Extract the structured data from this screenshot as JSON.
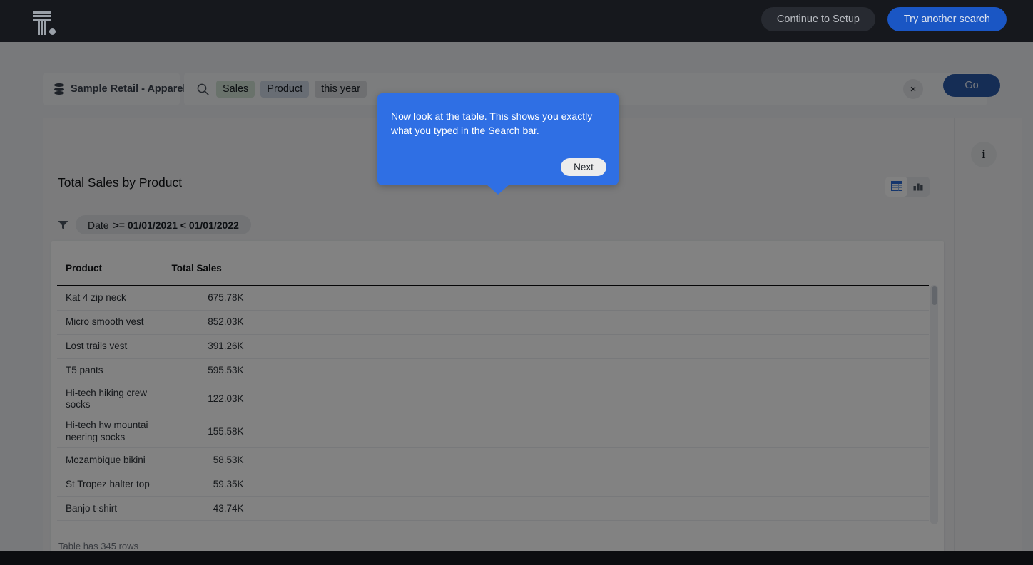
{
  "top_nav": {
    "logo_name": "thoughtspot-logo",
    "continue_setup_label": "Continue to Setup",
    "try_another_search_label": "Try another search"
  },
  "search": {
    "datasource": "Sample Retail - Apparel",
    "tokens": [
      {
        "text": "Sales",
        "kind": "measure"
      },
      {
        "text": "Product",
        "kind": "attribute"
      },
      {
        "text": "this year",
        "kind": "date"
      }
    ],
    "clear_label": "×",
    "go_label": "Go"
  },
  "answer": {
    "title": "Total Sales by Product",
    "filter": {
      "field": "Date",
      "value": ">= 01/01/2021 < 01/01/2022"
    },
    "view_toggle": {
      "table_icon": "table-icon",
      "chart_icon": "bar-chart-icon",
      "active": "table"
    },
    "info_label": "i"
  },
  "table": {
    "columns": [
      "Product",
      "Total Sales",
      ""
    ],
    "rows": [
      {
        "product": "Kat 4 zip neck",
        "total_sales": "675.78K"
      },
      {
        "product": "Micro smooth vest",
        "total_sales": "852.03K"
      },
      {
        "product": "Lost trails vest",
        "total_sales": "391.26K"
      },
      {
        "product": "T5 pants",
        "total_sales": "595.53K"
      },
      {
        "product": "Hi-tech hiking crew socks",
        "total_sales": "122.03K"
      },
      {
        "product": "Hi-tech hw mountai neering socks",
        "total_sales": "155.58K"
      },
      {
        "product": "Mozambique bikini",
        "total_sales": "58.53K"
      },
      {
        "product": "St Tropez halter top",
        "total_sales": "59.35K"
      },
      {
        "product": "Banjo t-shirt",
        "total_sales": "43.74K"
      }
    ],
    "footer": "Table has 345 rows"
  },
  "coachmark": {
    "text": "Now look at the table. This shows you exactly what you typed in the Search bar.",
    "next_label": "Next"
  },
  "colors": {
    "nav_background": "#16181d",
    "primary_button": "#1a56c4",
    "secondary_button": "#272a31",
    "go_button": "#2a58a8",
    "coachmark": "#2f6fe4",
    "measure_token": "#cfe0d2",
    "attribute_token": "#ccd6e4",
    "date_token": "#d8dade"
  }
}
